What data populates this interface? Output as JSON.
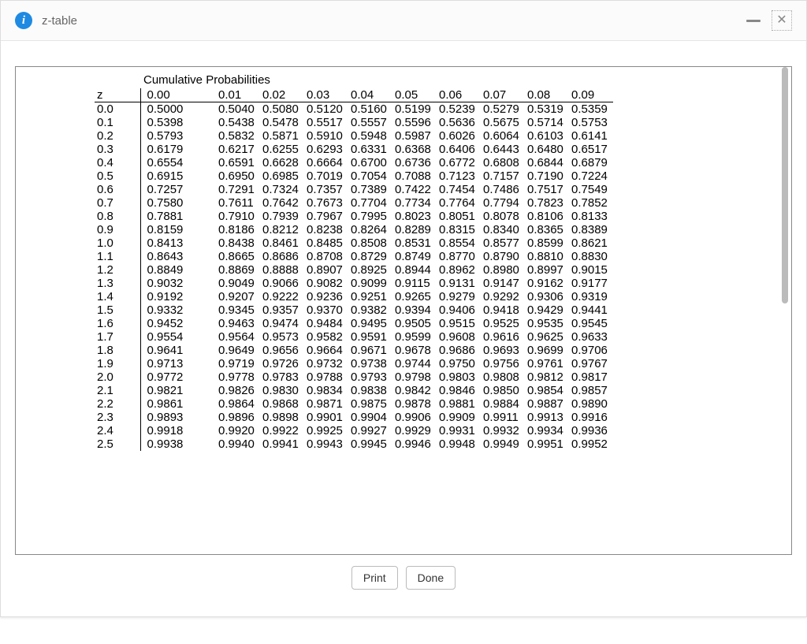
{
  "window": {
    "title": "z-table"
  },
  "table": {
    "caption": "Cumulative Probabilities",
    "header": [
      "z",
      "0.00",
      "0.01",
      "0.02",
      "0.03",
      "0.04",
      "0.05",
      "0.06",
      "0.07",
      "0.08",
      "0.09"
    ],
    "rows": [
      {
        "z": "0.0",
        "v": [
          "0.5000",
          "0.5040",
          "0.5080",
          "0.5120",
          "0.5160",
          "0.5199",
          "0.5239",
          "0.5279",
          "0.5319",
          "0.5359"
        ]
      },
      {
        "z": "0.1",
        "v": [
          "0.5398",
          "0.5438",
          "0.5478",
          "0.5517",
          "0.5557",
          "0.5596",
          "0.5636",
          "0.5675",
          "0.5714",
          "0.5753"
        ]
      },
      {
        "z": "0.2",
        "v": [
          "0.5793",
          "0.5832",
          "0.5871",
          "0.5910",
          "0.5948",
          "0.5987",
          "0.6026",
          "0.6064",
          "0.6103",
          "0.6141"
        ]
      },
      {
        "z": "0.3",
        "v": [
          "0.6179",
          "0.6217",
          "0.6255",
          "0.6293",
          "0.6331",
          "0.6368",
          "0.6406",
          "0.6443",
          "0.6480",
          "0.6517"
        ]
      },
      {
        "z": "0.4",
        "v": [
          "0.6554",
          "0.6591",
          "0.6628",
          "0.6664",
          "0.6700",
          "0.6736",
          "0.6772",
          "0.6808",
          "0.6844",
          "0.6879"
        ]
      },
      {
        "z": "0.5",
        "v": [
          "0.6915",
          "0.6950",
          "0.6985",
          "0.7019",
          "0.7054",
          "0.7088",
          "0.7123",
          "0.7157",
          "0.7190",
          "0.7224"
        ]
      },
      {
        "z": "0.6",
        "v": [
          "0.7257",
          "0.7291",
          "0.7324",
          "0.7357",
          "0.7389",
          "0.7422",
          "0.7454",
          "0.7486",
          "0.7517",
          "0.7549"
        ]
      },
      {
        "z": "0.7",
        "v": [
          "0.7580",
          "0.7611",
          "0.7642",
          "0.7673",
          "0.7704",
          "0.7734",
          "0.7764",
          "0.7794",
          "0.7823",
          "0.7852"
        ]
      },
      {
        "z": "0.8",
        "v": [
          "0.7881",
          "0.7910",
          "0.7939",
          "0.7967",
          "0.7995",
          "0.8023",
          "0.8051",
          "0.8078",
          "0.8106",
          "0.8133"
        ]
      },
      {
        "z": "0.9",
        "v": [
          "0.8159",
          "0.8186",
          "0.8212",
          "0.8238",
          "0.8264",
          "0.8289",
          "0.8315",
          "0.8340",
          "0.8365",
          "0.8389"
        ]
      },
      {
        "z": "1.0",
        "v": [
          "0.8413",
          "0.8438",
          "0.8461",
          "0.8485",
          "0.8508",
          "0.8531",
          "0.8554",
          "0.8577",
          "0.8599",
          "0.8621"
        ]
      },
      {
        "z": "1.1",
        "v": [
          "0.8643",
          "0.8665",
          "0.8686",
          "0.8708",
          "0.8729",
          "0.8749",
          "0.8770",
          "0.8790",
          "0.8810",
          "0.8830"
        ]
      },
      {
        "z": "1.2",
        "v": [
          "0.8849",
          "0.8869",
          "0.8888",
          "0.8907",
          "0.8925",
          "0.8944",
          "0.8962",
          "0.8980",
          "0.8997",
          "0.9015"
        ]
      },
      {
        "z": "1.3",
        "v": [
          "0.9032",
          "0.9049",
          "0.9066",
          "0.9082",
          "0.9099",
          "0.9115",
          "0.9131",
          "0.9147",
          "0.9162",
          "0.9177"
        ]
      },
      {
        "z": "1.4",
        "v": [
          "0.9192",
          "0.9207",
          "0.9222",
          "0.9236",
          "0.9251",
          "0.9265",
          "0.9279",
          "0.9292",
          "0.9306",
          "0.9319"
        ]
      },
      {
        "z": "1.5",
        "v": [
          "0.9332",
          "0.9345",
          "0.9357",
          "0.9370",
          "0.9382",
          "0.9394",
          "0.9406",
          "0.9418",
          "0.9429",
          "0.9441"
        ]
      },
      {
        "z": "1.6",
        "v": [
          "0.9452",
          "0.9463",
          "0.9474",
          "0.9484",
          "0.9495",
          "0.9505",
          "0.9515",
          "0.9525",
          "0.9535",
          "0.9545"
        ]
      },
      {
        "z": "1.7",
        "v": [
          "0.9554",
          "0.9564",
          "0.9573",
          "0.9582",
          "0.9591",
          "0.9599",
          "0.9608",
          "0.9616",
          "0.9625",
          "0.9633"
        ]
      },
      {
        "z": "1.8",
        "v": [
          "0.9641",
          "0.9649",
          "0.9656",
          "0.9664",
          "0.9671",
          "0.9678",
          "0.9686",
          "0.9693",
          "0.9699",
          "0.9706"
        ]
      },
      {
        "z": "1.9",
        "v": [
          "0.9713",
          "0.9719",
          "0.9726",
          "0.9732",
          "0.9738",
          "0.9744",
          "0.9750",
          "0.9756",
          "0.9761",
          "0.9767"
        ]
      },
      {
        "z": "2.0",
        "v": [
          "0.9772",
          "0.9778",
          "0.9783",
          "0.9788",
          "0.9793",
          "0.9798",
          "0.9803",
          "0.9808",
          "0.9812",
          "0.9817"
        ]
      },
      {
        "z": "2.1",
        "v": [
          "0.9821",
          "0.9826",
          "0.9830",
          "0.9834",
          "0.9838",
          "0.9842",
          "0.9846",
          "0.9850",
          "0.9854",
          "0.9857"
        ]
      },
      {
        "z": "2.2",
        "v": [
          "0.9861",
          "0.9864",
          "0.9868",
          "0.9871",
          "0.9875",
          "0.9878",
          "0.9881",
          "0.9884",
          "0.9887",
          "0.9890"
        ]
      },
      {
        "z": "2.3",
        "v": [
          "0.9893",
          "0.9896",
          "0.9898",
          "0.9901",
          "0.9904",
          "0.9906",
          "0.9909",
          "0.9911",
          "0.9913",
          "0.9916"
        ]
      },
      {
        "z": "2.4",
        "v": [
          "0.9918",
          "0.9920",
          "0.9922",
          "0.9925",
          "0.9927",
          "0.9929",
          "0.9931",
          "0.9932",
          "0.9934",
          "0.9936"
        ]
      },
      {
        "z": "2.5",
        "v": [
          "0.9938",
          "0.9940",
          "0.9941",
          "0.9943",
          "0.9945",
          "0.9946",
          "0.9948",
          "0.9949",
          "0.9951",
          "0.9952"
        ]
      }
    ]
  },
  "footer": {
    "print": "Print",
    "done": "Done"
  }
}
